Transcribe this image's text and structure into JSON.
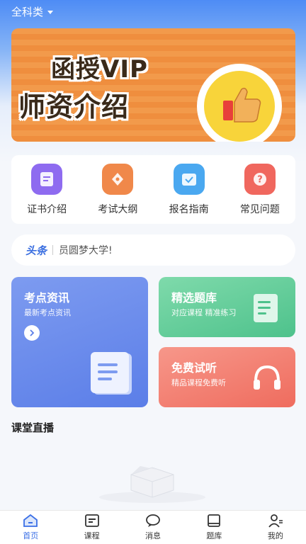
{
  "header": {
    "category": "全科类"
  },
  "banner": {
    "line1": "函授VIP",
    "line2": "师资介绍"
  },
  "quick_menu": [
    {
      "label": "证书介绍",
      "icon": "certificate-icon",
      "color": "#8e6bf0"
    },
    {
      "label": "考试大纲",
      "icon": "pen-icon",
      "color": "#f0884a"
    },
    {
      "label": "报名指南",
      "icon": "checklist-icon",
      "color": "#4aa8f0"
    },
    {
      "label": "常见问题",
      "icon": "question-icon",
      "color": "#f0675e"
    }
  ],
  "headline": {
    "tag": "头条",
    "text": "员圆梦大学!"
  },
  "cards": {
    "news": {
      "title": "考点资讯",
      "subtitle": "最新考点资讯"
    },
    "questions": {
      "title": "精选题库",
      "subtitle": "对应课程 精准练习"
    },
    "trial": {
      "title": "免费试听",
      "subtitle": "精品课程免费听"
    }
  },
  "section": {
    "title": "课堂直播"
  },
  "tabs": [
    {
      "label": "首页",
      "icon": "home-icon",
      "active": true
    },
    {
      "label": "课程",
      "icon": "course-icon",
      "active": false
    },
    {
      "label": "消息",
      "icon": "message-icon",
      "active": false
    },
    {
      "label": "题库",
      "icon": "book-icon",
      "active": false
    },
    {
      "label": "我的",
      "icon": "profile-icon",
      "active": false
    }
  ],
  "colors": {
    "accent": "#3a6fe6"
  }
}
